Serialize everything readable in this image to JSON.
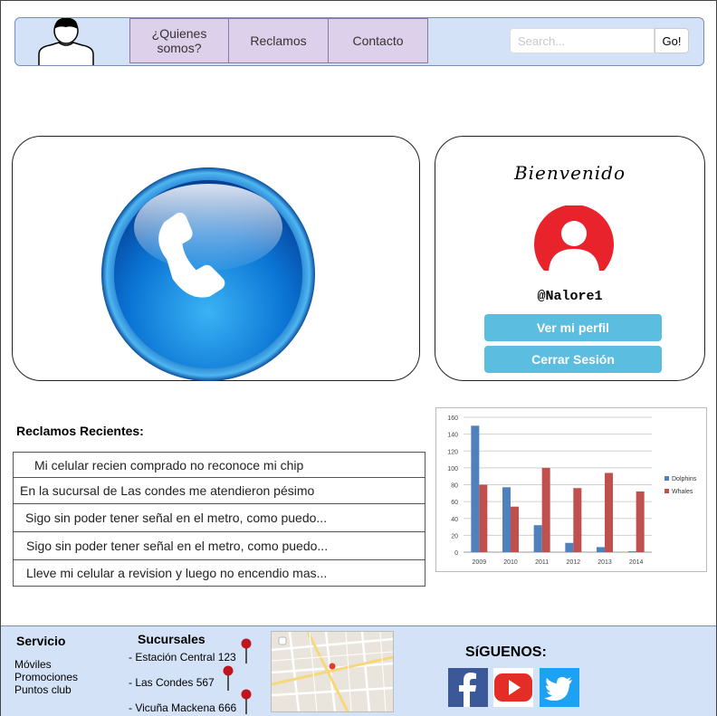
{
  "nav": {
    "items": [
      "¿Quienes somos?",
      "Reclamos",
      "Contacto"
    ],
    "search_placeholder": "Search...",
    "go_label": "Go!"
  },
  "welcome": {
    "title": "Bienvenido",
    "username": "@Nalore1",
    "profile_button": "Ver mi perfil",
    "logout_button": "Cerrar Sesión"
  },
  "recent": {
    "title": "Reclamos Recientes:",
    "items": [
      "Mi celular recien comprado no reconoce mi chip",
      "En la sucursal de Las condes me atendieron pésimo",
      "Sigo sin poder tener señal en el metro, como puedo...",
      "Sigo sin poder tener señal en el metro, como puedo...",
      "Lleve mi celular a revision y luego no encendio mas..."
    ]
  },
  "chart_data": {
    "type": "bar",
    "categories": [
      "2009",
      "2010",
      "2011",
      "2012",
      "2013",
      "2014"
    ],
    "series": [
      {
        "name": "Dolphins",
        "values": [
          150,
          77,
          32,
          11,
          6,
          1
        ],
        "color": "#4f81bd"
      },
      {
        "name": "Whales",
        "values": [
          80,
          54,
          100,
          76,
          94,
          72
        ],
        "color": "#c0504d"
      }
    ],
    "yticks": [
      "0",
      "20",
      "40",
      "60",
      "80",
      "100",
      "120",
      "140",
      "160"
    ],
    "ylim": [
      0,
      160
    ],
    "grid": true,
    "legend": "right"
  },
  "footer": {
    "service_title": "Servicio",
    "service_items": [
      "Móviles",
      "Promociones",
      "Puntos club"
    ],
    "branches_title": "Sucursales",
    "branches": [
      "- Estación Central 123",
      "- Las Condes 567",
      "- Vicuña Mackena 666"
    ],
    "follow_title": "SíGUENOS:",
    "social": [
      "facebook-icon",
      "youtube-icon",
      "twitter-icon"
    ]
  }
}
